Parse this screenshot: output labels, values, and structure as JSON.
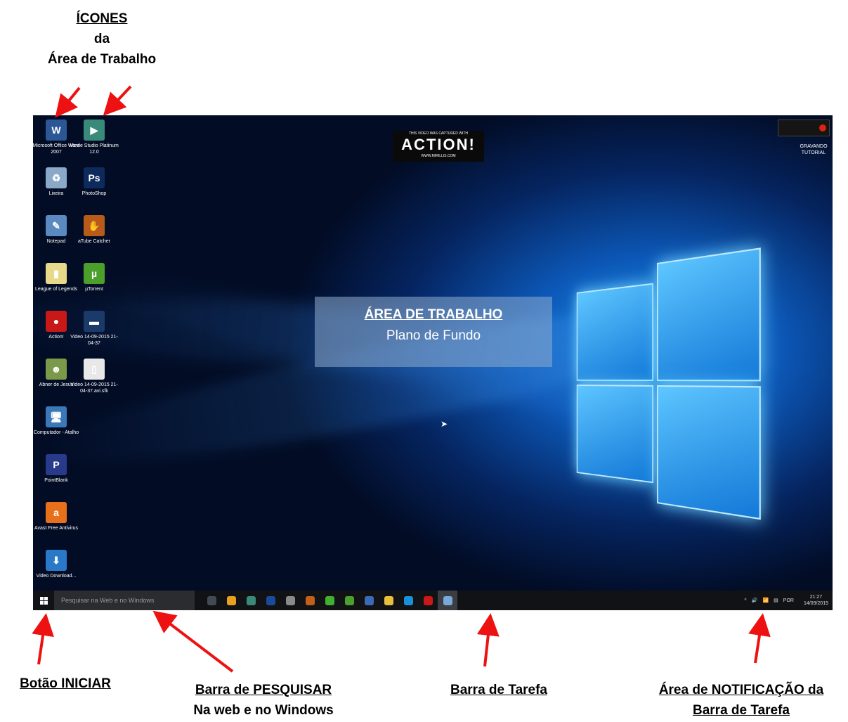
{
  "header": {
    "line1": "ÍCONES",
    "line2": "da",
    "line3": "Área de Trabalho"
  },
  "desktop": {
    "watermark": {
      "caption": "THIS VIDEO WAS CAPTURED WITH",
      "word": "ACTION!",
      "url": "WWW.MIRILLIS.COM"
    },
    "recording_label": "GRAVANDO TUTORIAL",
    "icons": [
      {
        "name": "Microsoft Office Word 2007",
        "glyph": "W",
        "color": "#2b5797"
      },
      {
        "name": "Movie Studio Platinum 12.0",
        "glyph": "▶",
        "color": "#3a8a7a"
      },
      {
        "name": "Lixeira",
        "glyph": "♻",
        "color": "#8aa8c8"
      },
      {
        "name": "PhotoShop",
        "glyph": "Ps",
        "color": "#0d2a5c"
      },
      {
        "name": "Notepad",
        "glyph": "✎",
        "color": "#5a8ac0"
      },
      {
        "name": "aTube Catcher",
        "glyph": "✋",
        "color": "#b85a1a"
      },
      {
        "name": "League of Legends",
        "glyph": "▮",
        "color": "#e8d88a"
      },
      {
        "name": "µTorrent",
        "glyph": "µ",
        "color": "#4aa02a"
      },
      {
        "name": "Action!",
        "glyph": "●",
        "color": "#c81818"
      },
      {
        "name": "Video 14-09-2015 21-04-37",
        "glyph": "▬",
        "color": "#1a3a6a"
      },
      {
        "name": "Abner de Jesus",
        "glyph": "☻",
        "color": "#7a9a4a"
      },
      {
        "name": "Video 14-09-2015 21-04-37.avi.sfk",
        "glyph": "▯",
        "color": "#e8e8e8"
      },
      {
        "name": "Computador - Atalho",
        "glyph": "🖥",
        "color": "#3a78b8"
      },
      {
        "name": "PointBlank",
        "glyph": "P",
        "color": "#2a3a8a"
      },
      {
        "name": "Avast Free Antivirus",
        "glyph": "a",
        "color": "#e8701a"
      },
      {
        "name": "Video Download...",
        "glyph": "⬇",
        "color": "#2a78c8"
      }
    ],
    "overlay": {
      "title": "ÁREA DE TRABALHO",
      "subtitle": "Plano de Fundo"
    }
  },
  "taskbar": {
    "search_placeholder": "Pesquisar na Web e no Windows",
    "apps": [
      {
        "name": "task-view",
        "color": "#444a52"
      },
      {
        "name": "chrome",
        "color": "#e8a020"
      },
      {
        "name": "movie-studio",
        "color": "#3a8a7a"
      },
      {
        "name": "photoshop",
        "color": "#1a4a9a"
      },
      {
        "name": "tool",
        "color": "#8a8a8a"
      },
      {
        "name": "atube",
        "color": "#c0601a"
      },
      {
        "name": "spotify",
        "color": "#40b030"
      },
      {
        "name": "utorrent",
        "color": "#4aa02a"
      },
      {
        "name": "calculator",
        "color": "#3a6ab8"
      },
      {
        "name": "file-explorer",
        "color": "#e8c040"
      },
      {
        "name": "skype",
        "color": "#1a90d8"
      },
      {
        "name": "action",
        "color": "#c81818"
      },
      {
        "name": "active-app",
        "color": "#7aa8d8"
      }
    ],
    "tray": {
      "chevron": "^",
      "volume": "🔊",
      "language": "POR",
      "time": "21:27",
      "date": "14/09/2015"
    }
  },
  "labels": {
    "start": "Botão INICIAR",
    "search_1": "Barra de PESQUISAR",
    "search_2": "Na web e no Windows",
    "taskbar": "Barra de Tarefa",
    "notif_1": "Área de NOTIFICAÇÃO da",
    "notif_2": "Barra de Tarefa"
  },
  "colors": {
    "arrow": "#ee1111",
    "taskbar": "#101215"
  }
}
